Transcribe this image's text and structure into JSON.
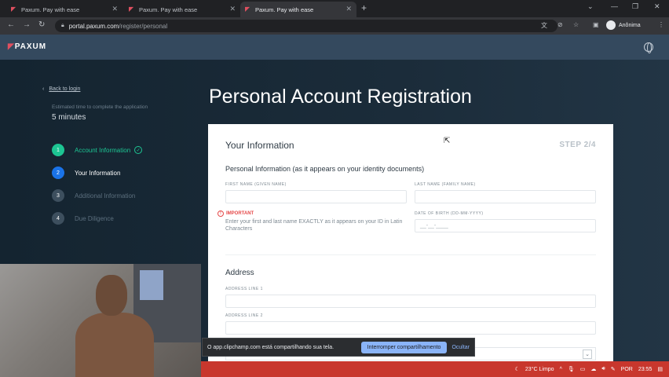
{
  "browser": {
    "tabs": [
      {
        "title": "Paxum. Pay with ease"
      },
      {
        "title": "Paxum. Pay with ease"
      },
      {
        "title": "Paxum. Pay with ease"
      }
    ],
    "url_host": "portal.paxum.com",
    "url_path": "/register/personal",
    "profile_label": "Anônima"
  },
  "site": {
    "logo": "PAXUM"
  },
  "sidebar": {
    "back_label": "Back to login",
    "estimate_label": "Estimated time to complete the application",
    "estimate_value": "5 minutes",
    "steps": [
      {
        "num": "1",
        "label": "Account Information",
        "state": "done"
      },
      {
        "num": "2",
        "label": "Your Information",
        "state": "current"
      },
      {
        "num": "3",
        "label": "Additional Information",
        "state": "todo"
      },
      {
        "num": "4",
        "label": "Due Diligence",
        "state": "todo"
      }
    ]
  },
  "page": {
    "title": "Personal Account Registration"
  },
  "form": {
    "section_title": "Your Information",
    "step_indicator": "STEP 2/4",
    "subheading": "Personal Information (as it appears on your identity documents)",
    "first_name_label": "FIRST NAME (GIVEN NAME)",
    "last_name_label": "LAST NAME (FAMILY NAME)",
    "important_label": "IMPORTANT",
    "important_text": "Enter your first and last name EXACTLY as it appears on your ID in Latin Characters",
    "dob_label": "DATE OF BIRTH (DD-MM-YYYY)",
    "dob_placeholder": "__-__-____",
    "address_heading": "Address",
    "address1_label": "ADDRESS LINE 1",
    "address2_label": "ADDRESS LINE 2"
  },
  "sharebar": {
    "message": "O app.clipchamp.com está compartilhando sua tela.",
    "stop_label": "Interromper compartilhamento",
    "hide_label": "Ocultar"
  },
  "taskbar": {
    "weather": "23°C  Limpo",
    "lang": "POR",
    "time": "23:55"
  }
}
